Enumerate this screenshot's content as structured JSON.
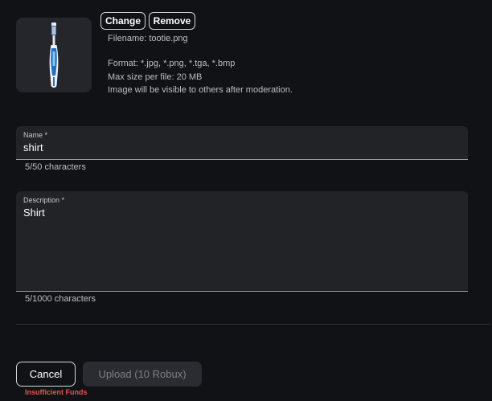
{
  "image": {
    "icon": "toothbrush-image",
    "change_label": "Change",
    "remove_label": "Remove",
    "filename": "Filename: tootie.png",
    "format": "Format: *.jpg, *.png, *.tga, *.bmp",
    "max_size": "Max size per file: 20 MB",
    "visibility_note": "Image will be visible to others after moderation."
  },
  "name_field": {
    "label": "Name *",
    "value": "shirt",
    "count": "5/50 characters"
  },
  "description_field": {
    "label": "Description *",
    "value": "Shirt",
    "count": "5/1000 characters"
  },
  "actions": {
    "cancel_label": "Cancel",
    "upload_label": "Upload (10 Robux)",
    "error": "Insufficient Funds"
  },
  "colors": {
    "background": "#111216",
    "field_background": "#222327",
    "error": "#e2564b"
  }
}
